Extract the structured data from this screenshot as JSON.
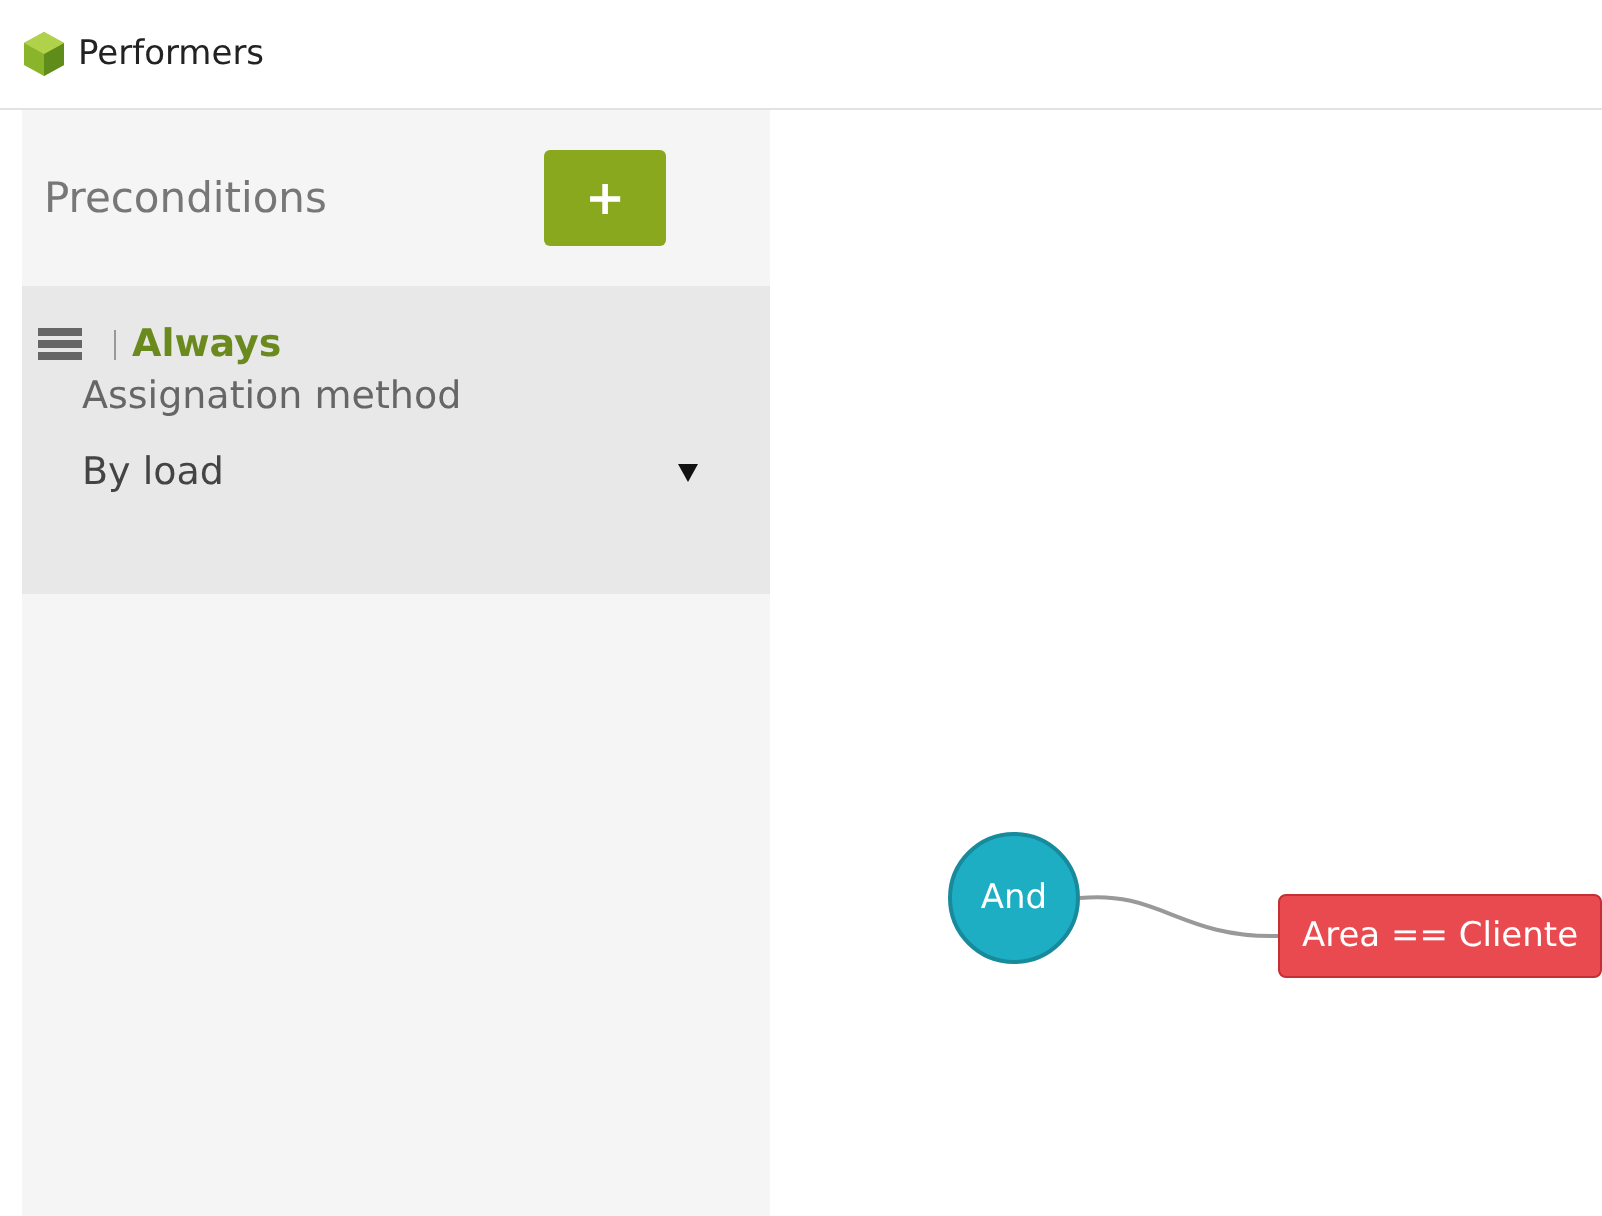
{
  "window": {
    "title": "Performers"
  },
  "sidebar": {
    "title": "Preconditions",
    "add_button": "+",
    "items": [
      {
        "name": "Always",
        "field_label": "Assignation method",
        "value": "By load",
        "selected": true
      }
    ]
  },
  "canvas": {
    "nodes": [
      {
        "kind": "circle",
        "label": "And",
        "color": "#1eaec4"
      },
      {
        "kind": "rect",
        "label": "Area == Cliente",
        "color": "#e84a4f"
      }
    ]
  }
}
